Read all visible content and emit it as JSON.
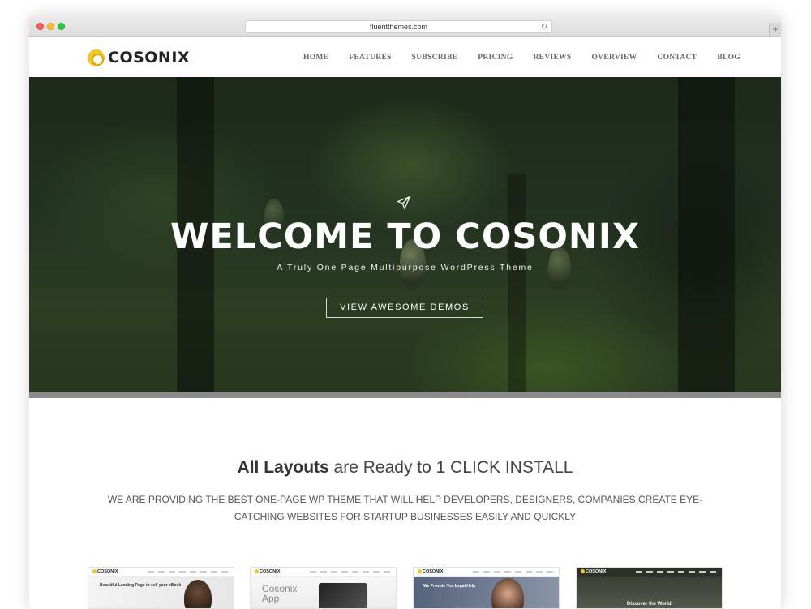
{
  "browser": {
    "url": "fluentthemes.com",
    "reload_icon": "reload-icon",
    "new_tab_label": "+"
  },
  "header": {
    "logo_text": "COSONIX",
    "nav": [
      "HOME",
      "FEATURES",
      "SUBSCRIBE",
      "PRICING",
      "REVIEWS",
      "OVERVIEW",
      "CONTACT",
      "BLOG"
    ]
  },
  "hero": {
    "icon": "paper-plane-icon",
    "title": "WELCOME TO COSONIX",
    "subtitle": "A Truly One Page Multipurpose WordPress Theme",
    "button": "VIEW AWESOME DEMOS"
  },
  "layouts": {
    "title_strong": "All Layouts",
    "title_rest": " are Ready to 1 CLICK INSTALL",
    "description": "WE ARE PROVIDING THE BEST ONE-PAGE WP THEME THAT WILL HELP DEVELOPERS, DESIGNERS, COMPANIES CREATE EYE-CATCHING WEBSITES FOR STARTUP BUSINESSES EASILY AND QUICKLY"
  },
  "thumbnails": [
    {
      "logo": "COSONIX",
      "caption": "Beautiful Landing Page to sell your eBook"
    },
    {
      "logo": "COSONIX",
      "caption": "Cosonix App"
    },
    {
      "logo": "COSONIX",
      "caption": "We Provide You Legal Help"
    },
    {
      "logo": "COSONIX",
      "caption": "Discover the World"
    }
  ],
  "colors": {
    "brand_yellow": "#f3c623",
    "hero_dark": "#223121",
    "nav_text": "#666666"
  }
}
